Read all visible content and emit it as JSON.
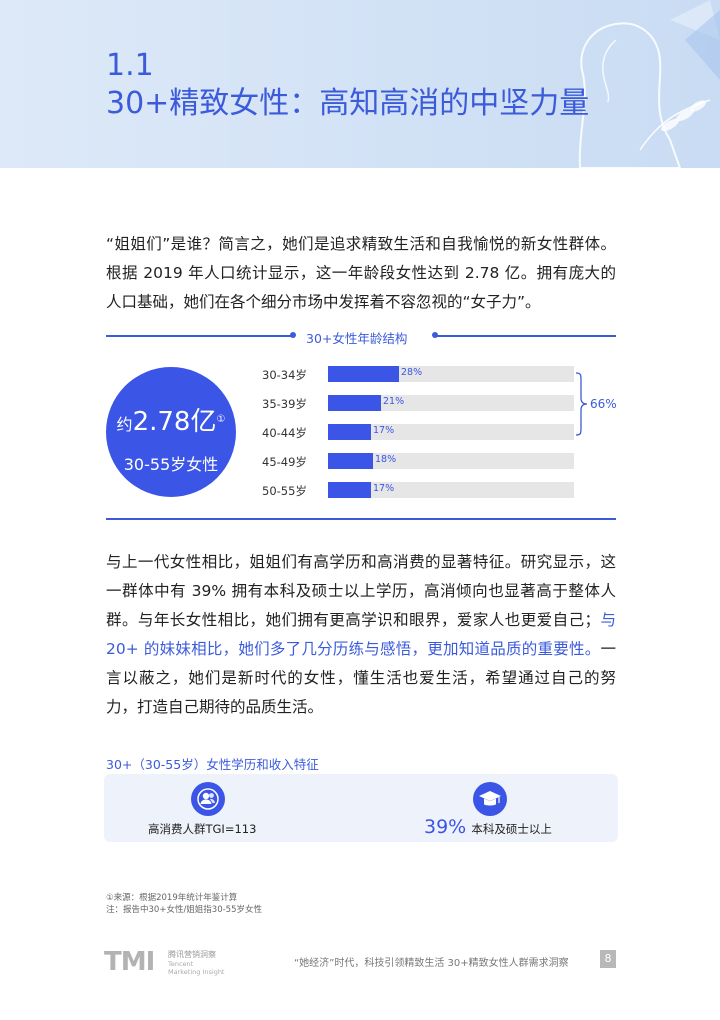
{
  "header": {
    "section_number": "1.1",
    "section_title": "30+精致女性：高知高消的中坚力量"
  },
  "intro_paragraph": "“姐姐们”是谁？简言之，她们是追求精致生活和自我愉悦的新女性群体。根据 2019 年人口统计显示，这一年龄段女性达到 2.78 亿。拥有庞大的人口基础，她们在各个细分市场中发挥着不容忽视的“女子力”。",
  "age_structure": {
    "title": "30+女性年龄结构",
    "total_prefix": "约",
    "total_value": "2.78亿",
    "total_footnote_mark": "①",
    "total_caption": "30-55岁女性",
    "group_total_label": "66%",
    "rows": [
      {
        "label": "30-34岁",
        "pct_label": "28%"
      },
      {
        "label": "35-39岁",
        "pct_label": "21%"
      },
      {
        "label": "40-44岁",
        "pct_label": "17%"
      },
      {
        "label": "45-49岁",
        "pct_label": "18%"
      },
      {
        "label": "50-55岁",
        "pct_label": "17%"
      }
    ]
  },
  "chart_data": {
    "type": "bar",
    "title": "30+女性年龄结构",
    "categories": [
      "30-34岁",
      "35-39岁",
      "40-44岁",
      "45-49岁",
      "50-55岁"
    ],
    "values": [
      28,
      21,
      17,
      18,
      17
    ],
    "unit": "%",
    "annotation": "66%"
  },
  "body_paragraph": {
    "part1": "与上一代女性相比，姐姐们有高学历和高消费的显著特征。研究显示，这一群体中有 39% 拥有本科及硕士以上学历，高消倾向也显著高于整体人群。与年长女性相比，她们拥有更高学识和眼界，爱家人也更爱自己；",
    "highlight": "与 20+ 的妹妹相比，她们多了几分历练与感悟，更加知道品质的重要性。",
    "part2": "一言以蔽之，她们是新时代的女性，懂生活也爱生活，希望通过自己的努力，打造自己期待的品质生活。"
  },
  "feature_box": {
    "title": "30+（30-55岁）女性学历和收入特征",
    "item1_text": "高消费人群TGI=113",
    "item1_icon": "people-icon",
    "item2_number": "39%",
    "item2_text": "本科及硕士以上",
    "item2_icon": "graduation-cap-icon"
  },
  "notes": {
    "line1": "①来源：根据2019年统计年鉴计算",
    "line2": "注：报告中30+女性/姐姐指30-55岁女性"
  },
  "footer": {
    "logo_mark": "TMI",
    "logo_cn": "腾讯营销洞察",
    "logo_en1": "Tencent",
    "logo_en2": "Marketing Insight",
    "report_title": "“她经济”时代，科技引领精致生活 30+精致女性人群需求洞察",
    "page_number": "8"
  },
  "colors": {
    "accent": "#3b5bdb",
    "bar": "#3b55e6",
    "track": "#e6e6e6"
  }
}
